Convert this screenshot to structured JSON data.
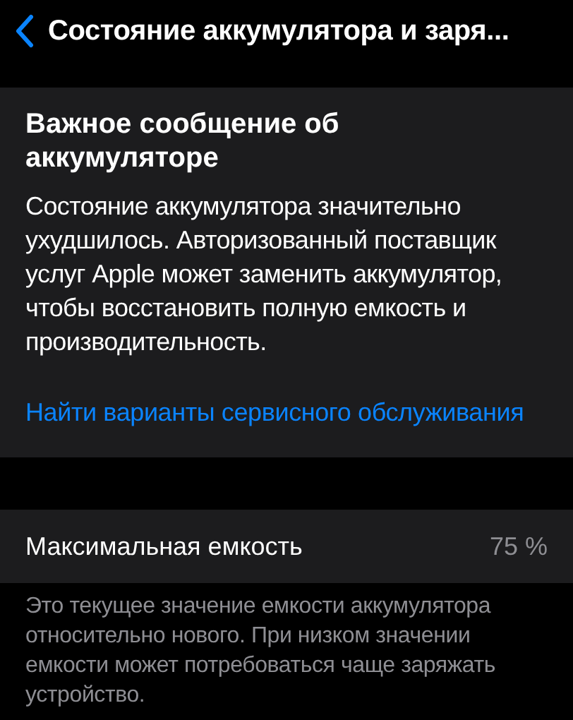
{
  "nav": {
    "title": "Состояние аккумулятора и заря..."
  },
  "notice": {
    "title": "Важное сообщение об аккумуляторе",
    "body": "Состояние аккумулятора значительно ухудшилось. Авторизованный поставщик услуг Apple может заменить аккумулятор, чтобы восстановить полную емкость и производительность.",
    "link": "Найти варианты сервисного обслуживания"
  },
  "capacity": {
    "label": "Максимальная емкость",
    "value": "75 %",
    "footer": "Это текущее значение емкости аккумулятора относительно нового. При низком значении емкости может потребоваться чаще заряжать устройство."
  }
}
